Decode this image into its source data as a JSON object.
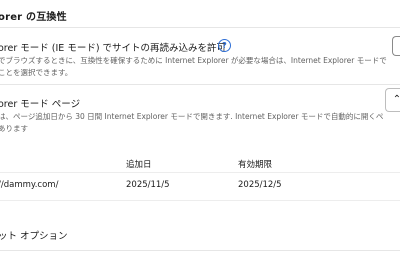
{
  "section": {
    "title": "orer の互換性"
  },
  "reload_setting": {
    "title": "orer モード (IE モード) でサイトの再読み込みを許可",
    "help_icon": "help-circle-icon",
    "help_glyph": "?",
    "description_line1": "でブラウズするときに、互換性を確保するために Internet Explorer が必要な場合は、Internet Explorer モードで",
    "description_line2": "ことを選択できます。"
  },
  "ie_pages": {
    "title": "orer モード ページ",
    "add_button_glyph": "⌃",
    "description_line1": "は、ページ追加日から 30 日間 Internet Explorer モードで開きます. Internet Explorer モードで自動的に開くペ",
    "description_line2": "あります",
    "table": {
      "columns": [
        "",
        "追加日",
        "有効期限"
      ],
      "rows": [
        {
          "page": "//dammy.com/",
          "added": "2025/11/5",
          "expires": "2025/12/5"
        }
      ]
    }
  },
  "next_section": {
    "title": "ット オプション"
  }
}
